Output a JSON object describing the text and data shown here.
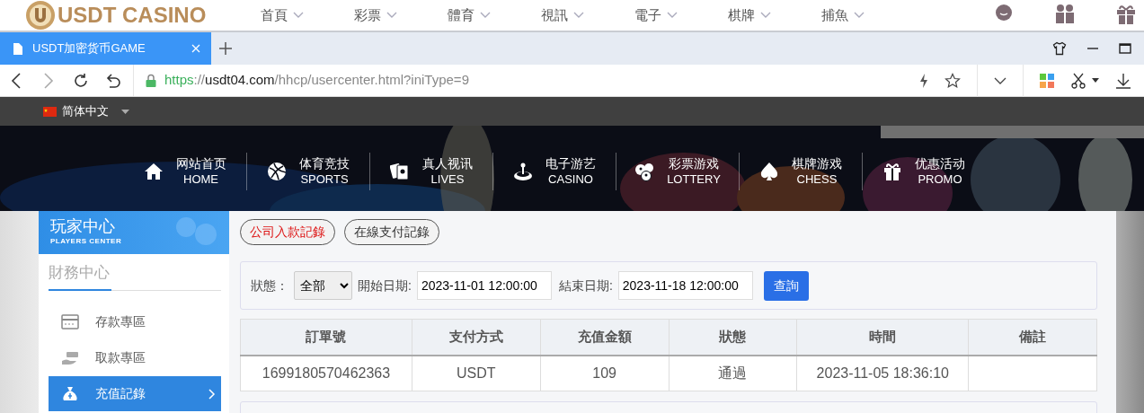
{
  "background_site": {
    "logo": "USDT CASINO",
    "menu": [
      {
        "label": "首頁"
      },
      {
        "label": "彩票"
      },
      {
        "label": "體育"
      },
      {
        "label": "視訊"
      },
      {
        "label": "電子"
      },
      {
        "label": "棋牌"
      },
      {
        "label": "捕魚"
      }
    ],
    "shortcuts": [
      {
        "kind": "chat"
      },
      {
        "kind": "members"
      },
      {
        "kind": "gift"
      }
    ]
  },
  "browser": {
    "tabs": [
      {
        "title": "USDT加密货币GAME",
        "selected": true
      }
    ],
    "address": [
      {
        "text": "https",
        "kind": "scheme"
      },
      {
        "text": "://",
        "kind": "plain"
      },
      {
        "text": "usdt04.com",
        "kind": "host"
      },
      {
        "text": "/hhcp/usercenter.html?iniType=9",
        "kind": "plain"
      }
    ]
  },
  "site": {
    "language": "简体中文",
    "nav": [
      {
        "label": "网站首页",
        "sublabel": "HOME",
        "kind": "home"
      },
      {
        "label": "体育竞技",
        "sublabel": "SPORTS",
        "kind": "sports"
      },
      {
        "label": "真人视讯",
        "sublabel": "LIVES",
        "kind": "cards"
      },
      {
        "label": "电子游艺",
        "sublabel": "CASINO",
        "kind": "casino"
      },
      {
        "label": "彩票游戏",
        "sublabel": "LOTTERY",
        "kind": "lottery"
      },
      {
        "label": "棋牌游戏",
        "sublabel": "CHESS",
        "kind": "chess"
      },
      {
        "label": "优惠活动",
        "sublabel": "PROMO",
        "kind": "gift"
      }
    ],
    "sidebar": {
      "title": "玩家中心",
      "subtitle": "PLAYERS CENTER",
      "section": "財務中心",
      "items": [
        {
          "label": "存款專區",
          "kind": "deposit",
          "selected": false
        },
        {
          "label": "取款專區",
          "kind": "withdraw",
          "selected": false
        },
        {
          "label": "充值記錄",
          "kind": "recharge",
          "selected": true
        }
      ]
    },
    "record_tabs": [
      {
        "label": "公司入款記錄",
        "selected": true
      },
      {
        "label": "在線支付記錄",
        "selected": false
      }
    ],
    "filter": {
      "fields": [
        {
          "label": "狀態：",
          "kind": "select",
          "value": "全部"
        },
        {
          "label": "開始日期:",
          "kind": "date",
          "value": "2023-11-01 12:00:00"
        },
        {
          "label": "結束日期:",
          "kind": "date",
          "value": "2023-11-18 12:00:00"
        }
      ],
      "button": "查詢"
    },
    "table": {
      "columns": [
        "訂單號",
        "支付方式",
        "充值金額",
        "狀態",
        "時間",
        "備註"
      ],
      "rows": [
        [
          "1699180570462363",
          "USDT",
          "109",
          "通過",
          "2023-11-05 18:36:10",
          ""
        ]
      ]
    }
  }
}
